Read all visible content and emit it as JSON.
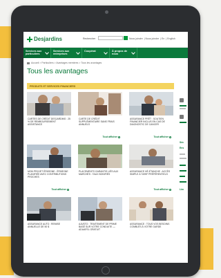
{
  "header": {
    "logo_text": "Desjardins",
    "search_label": "Rechercher",
    "search_placeholder": "",
    "util_links": [
      "Nous joindre",
      "Nous joindre",
      "En",
      "English"
    ]
  },
  "nav": {
    "items": [
      {
        "label": "Services aux particuliers"
      },
      {
        "label": "Services aux entreprises"
      },
      {
        "label": "Coopérat"
      },
      {
        "label": "À propos de nous"
      }
    ]
  },
  "breadcrumb": "Accueil > Particuliers > Avantages membres > Tous les avantages",
  "page_title": "Tous les avantages",
  "section_header": "PRODUITS ET SERVICES FINANCIERS",
  "more_label": "Tout afficher",
  "cards": [
    {
      "caption": "CARTES DE CRÉDIT DESJARDINS : 25 % DE REMBOURSEMENT ASSISTANCE"
    },
    {
      "caption": "CARTE DE CRÉDIT SUPPLÉMENTAIRE SANS FRAIS ANNUELS"
    },
    {
      "caption": "ASSURANCE PRÊT : SOUTIEN FINANCIER INCLUS EN CAS DE DIAGNOSTIC DE CANCER"
    },
    {
      "caption": "MON PROJET ÉPARGNE : ÉPARGNE PLANIFIÉE AVEC CONTRIBUTIONS PROCHES"
    },
    {
      "caption": "PLACEMENTS GARANTIS LIÉS AUX MARCHÉS : TAUX BONIFIÉS"
    },
    {
      "caption": "ASSURANCE HÉ-ÉTANCHE : ACCÈS SIMPLE À TARIF PRÉFÉRENTIELS"
    },
    {
      "caption": "ASSURANCE AUTO : REMISE ANNUELLE DE 50 $"
    },
    {
      "caption": "AJUSTO : TRAITEMENT DE PRIME BASÉ SUR VOTRE CONDUITE — ADUAFEL GRATUIT"
    },
    {
      "caption": "ASSURANCE : TOUS VOS BESOINS COMBLÉS À VOTRE GARDE"
    }
  ],
  "sidebar": {
    "labels": [
      "Séc",
      "Ens",
      "Lim"
    ]
  },
  "colors": {
    "brand_green": "#0b7a3c",
    "accent_yellow": "#f3bf3d",
    "section_bar": "#f4d45f"
  }
}
